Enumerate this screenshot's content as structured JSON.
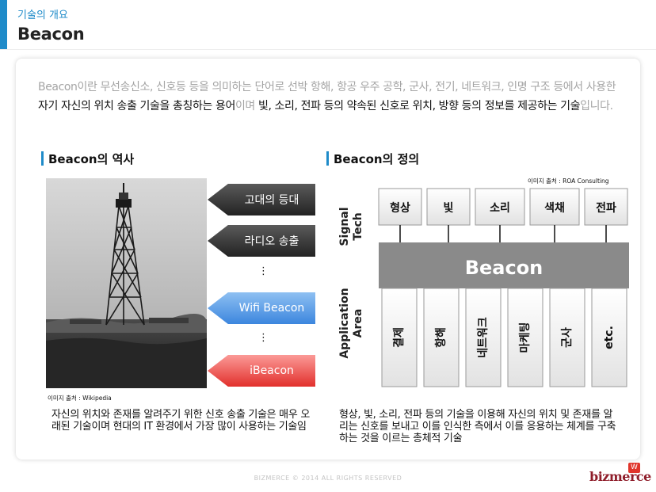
{
  "header": {
    "subtitle": "기술의 개요",
    "title": "Beacon"
  },
  "intro": {
    "part1": "Beacon이란 무선송신소, 신호등 등을 의미하는 단어로 선박 항해, 항공 우주 공학, 군사, 전기, 네트워크, 인명 구조 등에서 사용한 ",
    "part2": "자기 자신의 위치 송출 기술을 총칭하는 용어",
    "part3": "이며 ",
    "part4": "빛, 소리, 전파 등의 약속된 신호로 위치, 방향 등의 정보를 제공하는 기술",
    "part5": "입니다."
  },
  "history": {
    "heading": "Beacon의 역사",
    "photo_credit": "이미지 출처 : Wikipedia",
    "items": [
      "고대의 등대",
      "라디오 송출",
      "Wifi Beacon",
      "iBeacon"
    ],
    "dots": "⋮",
    "description": "자신의 위치와 존재를 알려주기 위한 신호 송출 기술은 매우 오래된 기술이며 현대의 IT 환경에서 가장 많이 사용하는 기술임"
  },
  "definition": {
    "heading": "Beacon의 정의",
    "image_credit": "이미지 출처 : ROA Consulting",
    "signal_label": [
      "Signal",
      "Tech"
    ],
    "signals": [
      "형상",
      "빛",
      "소리",
      "색채",
      "전파"
    ],
    "center_label": "Beacon",
    "application_label": [
      "Application",
      "Area"
    ],
    "areas": [
      "결제",
      "항해",
      "네트워크",
      "마케팅",
      "군사",
      "etc."
    ],
    "description": "형상, 빛, 소리, 전파 등의 기술을 이용해 자신의 위치 및 존재를 알리는 신호를 보내고 이를 인식한 측에서 이를 응용하는 체계를 구축하는 것을 이르는 총체적 기술"
  },
  "footer": {
    "copyright": "BIZMERCE © 2014 ALL RIGHTS RESERVED",
    "logo": "bizmerce",
    "logo_mark": "W"
  }
}
